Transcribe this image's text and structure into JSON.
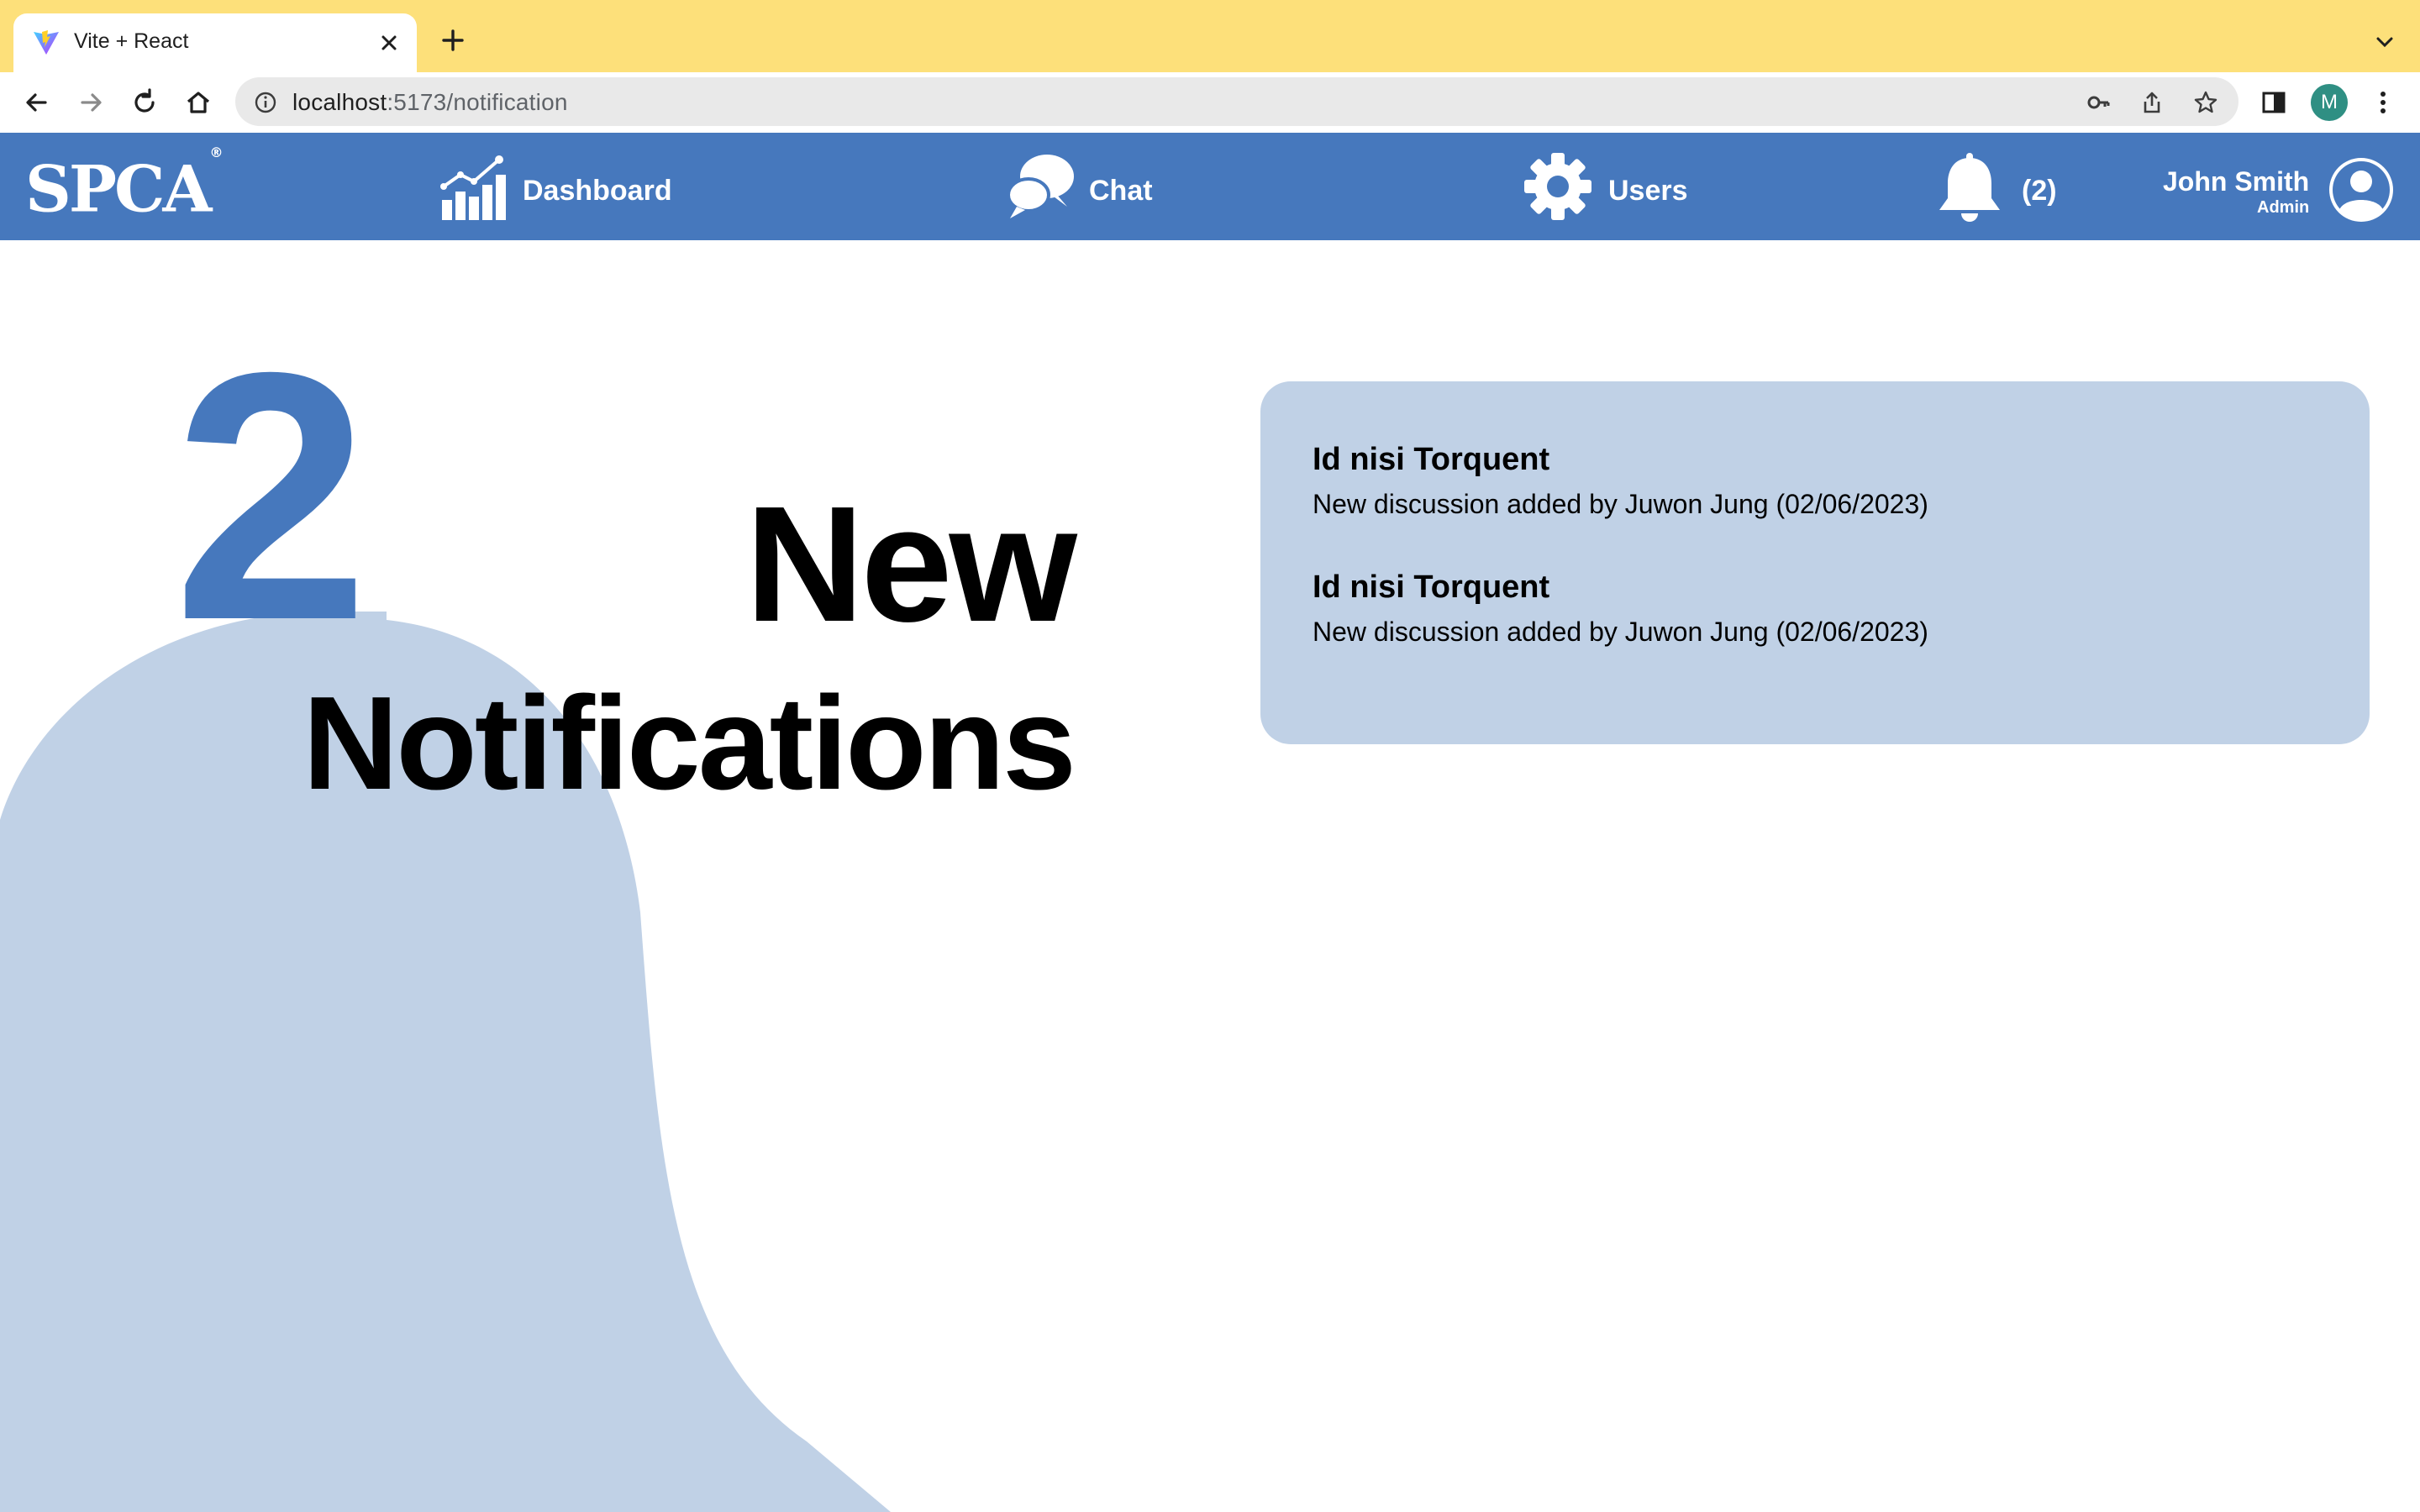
{
  "browser": {
    "tab_title": "Vite + React",
    "url_host": "localhost",
    "url_rest": ":5173/notification",
    "profile_initial": "M"
  },
  "nav": {
    "brand": "SPCA",
    "brand_mark": "®",
    "items": [
      {
        "label": "Dashboard",
        "icon": "bar-chart-icon"
      },
      {
        "label": "Chat",
        "icon": "chat-bubbles-icon"
      },
      {
        "label": "Users",
        "icon": "gear-icon"
      }
    ],
    "notification_count": "(2)",
    "user": {
      "name": "John Smith",
      "role": "Admin"
    }
  },
  "hero": {
    "count": "2",
    "line1": "New",
    "line2": "Notifications"
  },
  "notifications": [
    {
      "title": "Id nisi Torquent",
      "description": "New discussion added by Juwon Jung (02/06/2023)"
    },
    {
      "title": "Id nisi Torquent",
      "description": "New discussion added by Juwon Jung (02/06/2023)"
    }
  ],
  "colors": {
    "tabstrip": "#fde07a",
    "nav_blue": "#4678bd",
    "panel_blue": "#c0d1e6",
    "bell_shape": "#c0d1e6"
  }
}
